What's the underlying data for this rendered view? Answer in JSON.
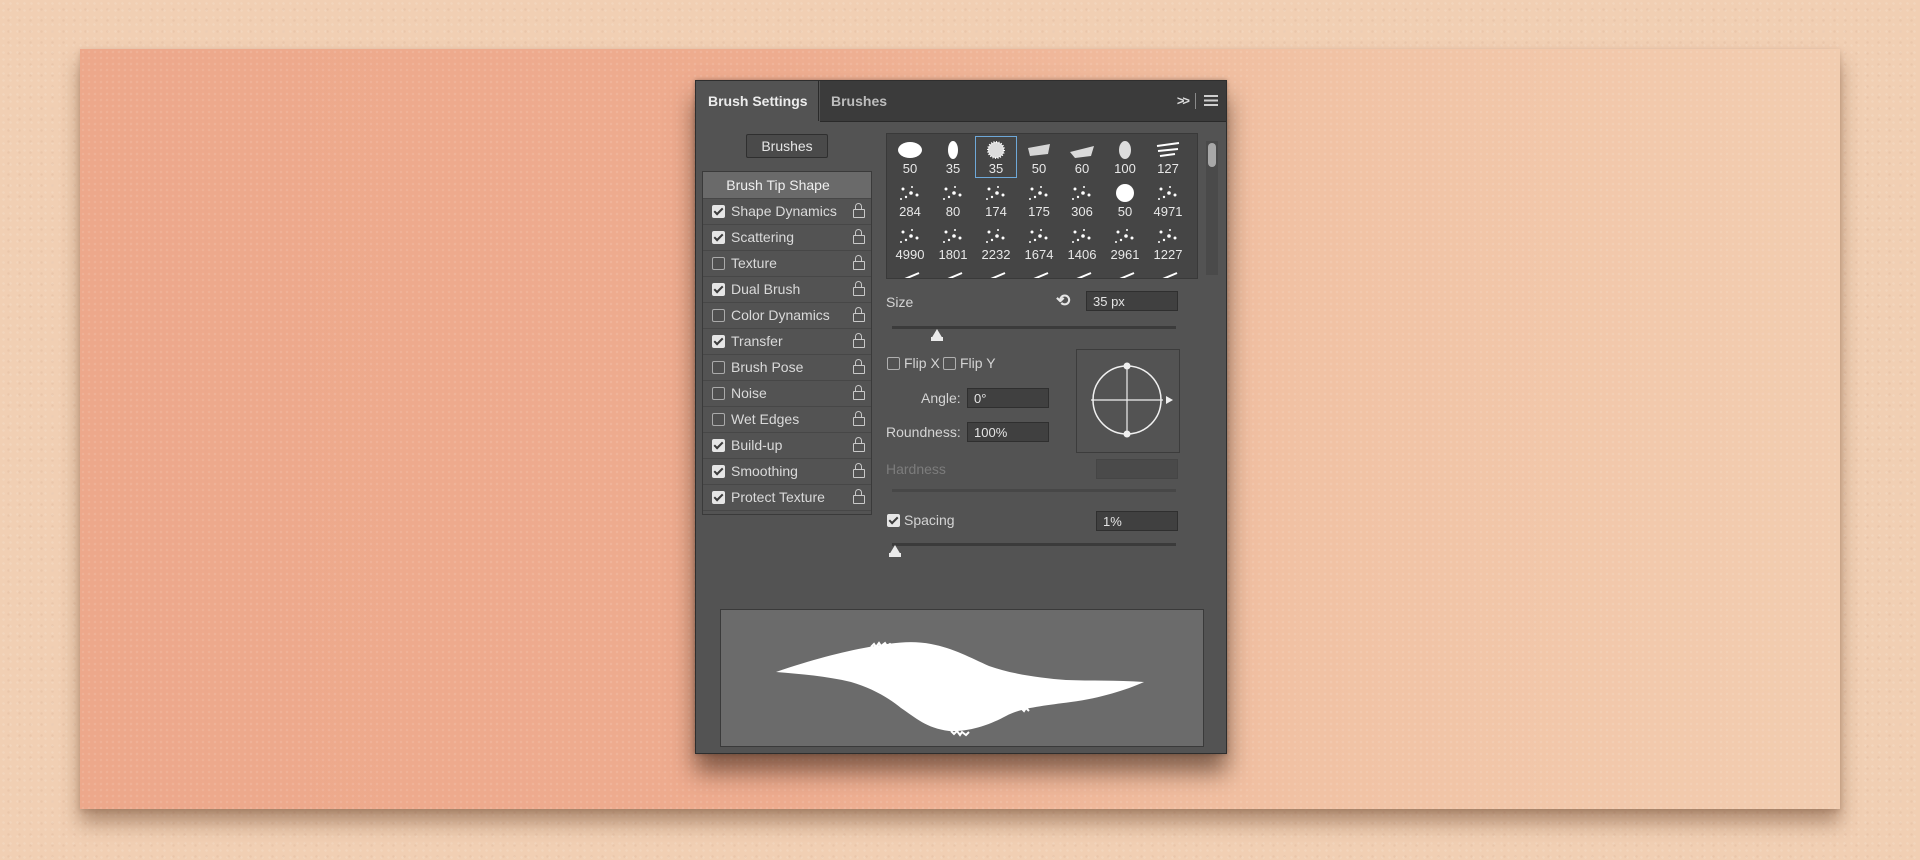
{
  "colors": {
    "panel": "#535353",
    "tabbar": "#3b3b3b",
    "selection": "#6ea8d8",
    "background": "#f1cfb3"
  },
  "tabs": [
    {
      "label": "Brush Settings",
      "active": true
    },
    {
      "label": "Brushes",
      "active": false
    }
  ],
  "header_icons": [
    "collapse-icon",
    "panel-menu-icon"
  ],
  "brushes_button": "Brushes",
  "options": [
    {
      "label": "Brush Tip Shape",
      "header": true
    },
    {
      "label": "Shape Dynamics",
      "checked": true
    },
    {
      "label": "Scattering",
      "checked": true
    },
    {
      "label": "Texture",
      "checked": false
    },
    {
      "label": "Dual Brush",
      "checked": true
    },
    {
      "label": "Color Dynamics",
      "checked": false
    },
    {
      "label": "Transfer",
      "checked": true
    },
    {
      "label": "Brush Pose",
      "checked": false
    },
    {
      "label": "Noise",
      "checked": false
    },
    {
      "label": "Wet Edges",
      "checked": false
    },
    {
      "label": "Build-up",
      "checked": true
    },
    {
      "label": "Smoothing",
      "checked": true
    },
    {
      "label": "Protect Texture",
      "checked": true
    }
  ],
  "presets": [
    "50",
    "35",
    "35",
    "50",
    "60",
    "100",
    "127",
    "284",
    "80",
    "174",
    "175",
    "306",
    "50",
    "4971",
    "4990",
    "1801",
    "2232",
    "1674",
    "1406",
    "2961",
    "1227"
  ],
  "selected_preset_index": 2,
  "size": {
    "label": "Size",
    "value": "35 px",
    "slider_fraction": 0.16
  },
  "flip_x": {
    "label": "Flip X",
    "checked": false
  },
  "flip_y": {
    "label": "Flip Y",
    "checked": false
  },
  "angle": {
    "label": "Angle:",
    "value": "0°"
  },
  "roundness": {
    "label": "Roundness:",
    "value": "100%"
  },
  "hardness": {
    "label": "Hardness",
    "value": ""
  },
  "spacing": {
    "label": "Spacing",
    "value": "1%",
    "checked": true,
    "slider_fraction": 0.01
  }
}
